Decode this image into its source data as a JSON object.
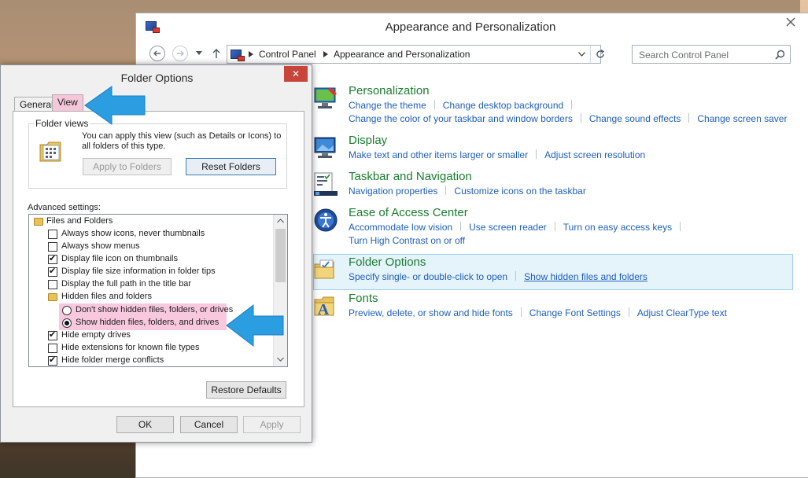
{
  "control_panel": {
    "title": "Appearance and Personalization",
    "breadcrumb": [
      "Control Panel",
      "Appearance and Personalization"
    ],
    "search_placeholder": "Search Control Panel",
    "categories": [
      {
        "title": "Personalization",
        "lines": [
          [
            "Change the theme",
            "Change desktop background"
          ],
          [
            "Change the color of your taskbar and window borders",
            "Change sound effects",
            "Change screen saver"
          ]
        ]
      },
      {
        "title": "Display",
        "lines": [
          [
            "Make text and other items larger or smaller",
            "Adjust screen resolution"
          ]
        ]
      },
      {
        "title": "Taskbar and Navigation",
        "lines": [
          [
            "Navigation properties",
            "Customize icons on the taskbar"
          ]
        ]
      },
      {
        "title": "Ease of Access Center",
        "lines": [
          [
            "Accommodate low vision",
            "Use screen reader",
            "Turn on easy access keys"
          ],
          [
            "Turn High Contrast on or off"
          ]
        ]
      },
      {
        "title": "Folder Options",
        "lines": [
          [
            "Specify single- or double-click to open",
            "Show hidden files and folders"
          ]
        ]
      },
      {
        "title": "Fonts",
        "lines": [
          [
            "Preview, delete, or show and hide fonts",
            "Change Font Settings",
            "Adjust ClearType text"
          ]
        ]
      }
    ]
  },
  "folder_options": {
    "title": "Folder Options",
    "close_glyph": "✕",
    "tabs": [
      "General",
      "View"
    ],
    "folder_views": {
      "label": "Folder views",
      "description": "You can apply this view (such as Details or Icons) to all folders of this type.",
      "apply_button": "Apply to Folders",
      "reset_button": "Reset Folders"
    },
    "advanced_label": "Advanced settings:",
    "tree": [
      {
        "type": "folder",
        "label": "Files and Folders",
        "indent": 0
      },
      {
        "type": "check",
        "label": "Always show icons, never thumbnails",
        "checked": false,
        "indent": 1
      },
      {
        "type": "check",
        "label": "Always show menus",
        "checked": false,
        "indent": 1
      },
      {
        "type": "check",
        "label": "Display file icon on thumbnails",
        "checked": true,
        "indent": 1
      },
      {
        "type": "check",
        "label": "Display file size information in folder tips",
        "checked": true,
        "indent": 1
      },
      {
        "type": "check",
        "label": "Display the full path in the title bar",
        "checked": false,
        "indent": 1
      },
      {
        "type": "folder",
        "label": "Hidden files and folders",
        "indent": 1
      },
      {
        "type": "radio",
        "label": "Don't show hidden files, folders, or drives",
        "checked": false,
        "indent": 2
      },
      {
        "type": "radio",
        "label": "Show hidden files, folders, and drives",
        "checked": true,
        "indent": 2
      },
      {
        "type": "check",
        "label": "Hide empty drives",
        "checked": true,
        "indent": 1
      },
      {
        "type": "check",
        "label": "Hide extensions for known file types",
        "checked": false,
        "indent": 1
      },
      {
        "type": "check",
        "label": "Hide folder merge conflicts",
        "checked": true,
        "indent": 1
      }
    ],
    "restore_defaults": "Restore Defaults",
    "ok": "OK",
    "cancel": "Cancel",
    "apply": "Apply"
  },
  "colors": {
    "accent_green": "#1b7d2f",
    "link_blue": "#1f5fb8",
    "highlight_pink": "#f8c8df",
    "arrow_blue": "#2a9ee0"
  }
}
